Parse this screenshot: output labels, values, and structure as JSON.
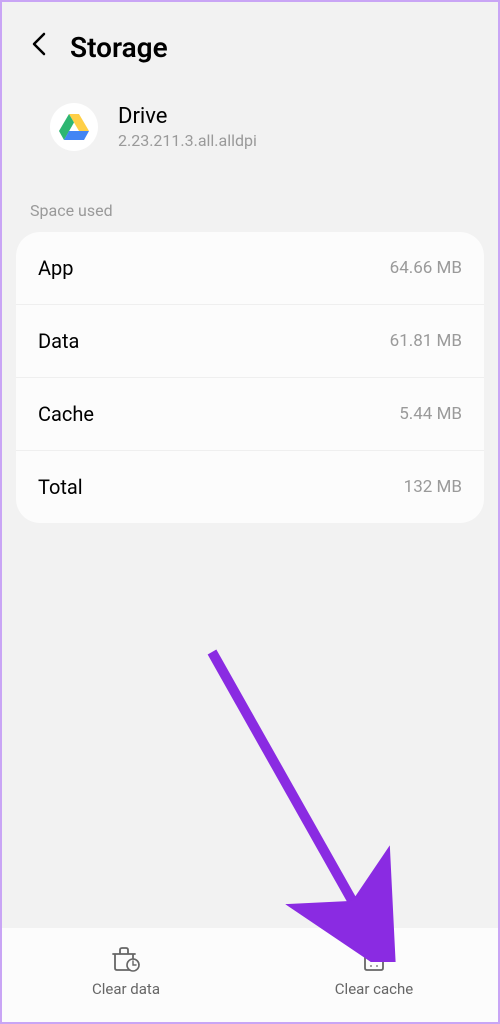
{
  "header": {
    "title": "Storage"
  },
  "app": {
    "name": "Drive",
    "version": "2.23.211.3.all.alldpi"
  },
  "section_label": "Space used",
  "rows": [
    {
      "label": "App",
      "value": "64.66 MB"
    },
    {
      "label": "Data",
      "value": "61.81 MB"
    },
    {
      "label": "Cache",
      "value": "5.44 MB"
    },
    {
      "label": "Total",
      "value": "132 MB"
    }
  ],
  "bottom": {
    "clear_data": "Clear data",
    "clear_cache": "Clear cache"
  },
  "annotation": {
    "arrow_color": "#8a2be2"
  }
}
